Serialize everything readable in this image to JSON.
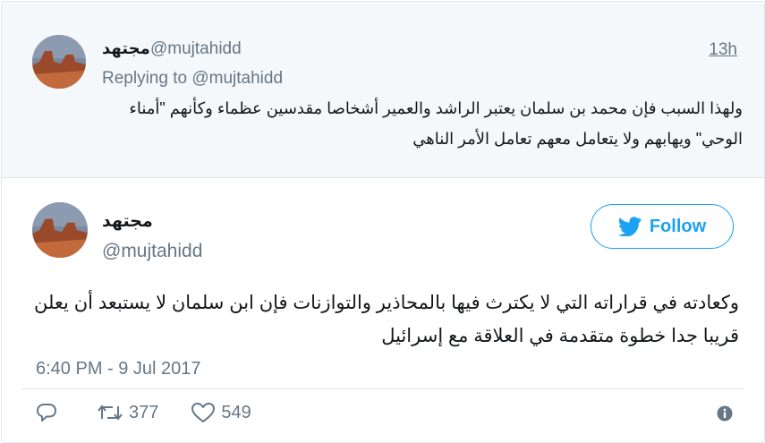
{
  "colors": {
    "accent": "#1da1f2",
    "muted": "#657786",
    "text": "#14171a",
    "reply_bg": "#f5f8fa"
  },
  "reply_tweet": {
    "name": "مجتهد",
    "handle": "@mujtahidd",
    "time": "13h",
    "replying_label": "Replying to",
    "replying_handle": "@mujtahidd",
    "text": "ولهذا السبب فإن محمد بن سلمان يعتبر الراشد والعمير أشخاصا مقدسين عظماء وكأنهم \"أمناء الوحي\" ويهابهم ولا يتعامل معهم تعامل الأمر الناهي"
  },
  "main_tweet": {
    "name": "مجتهد",
    "handle": "@mujtahidd",
    "follow_label": "Follow",
    "text": "وكعادته في قراراته التي لا يكترث فيها بالمحاذير والتوازنات فإن ابن سلمان لا يستبعد أن يعلن قريبا جدا خطوة متقدمة في العلاقة مع إسرائيل",
    "date": "6:40 PM - 9 Jul 2017",
    "retweets": "377",
    "likes": "549"
  },
  "icons": {
    "avatar": "desert-landscape-avatar",
    "follow": "bird-icon",
    "reply": "reply-bubble-icon",
    "retweet": "retweet-icon",
    "like": "heart-icon",
    "info": "info-icon"
  }
}
